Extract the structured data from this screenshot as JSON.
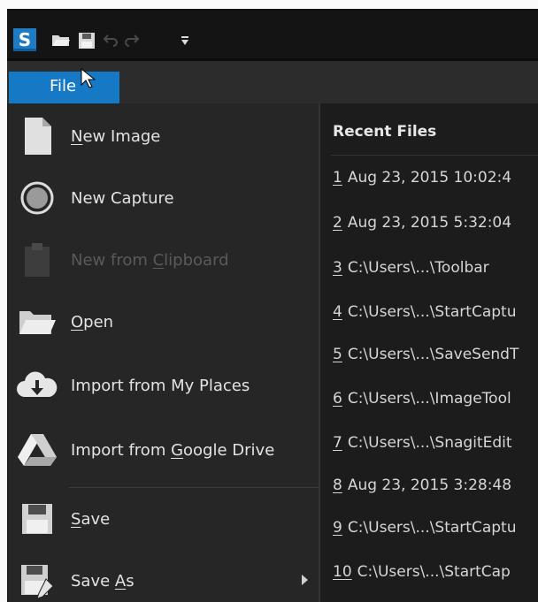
{
  "app": {
    "logo_letter": "S"
  },
  "menubar": {
    "file_tab": "File"
  },
  "file_menu": {
    "items": [
      {
        "label_pre": "",
        "label_u": "N",
        "label_post": "ew Image",
        "icon": "new-image-icon",
        "enabled": true
      },
      {
        "label_pre": "New Capture",
        "label_u": "",
        "label_post": "",
        "icon": "capture-circle-icon",
        "enabled": true
      },
      {
        "label_pre": "New from ",
        "label_u": "C",
        "label_post": "lipboard",
        "icon": "clipboard-icon",
        "enabled": false
      },
      {
        "label_pre": "",
        "label_u": "O",
        "label_post": "pen",
        "icon": "folder-open-icon",
        "enabled": true
      },
      {
        "label_pre": "Import from My Places",
        "label_u": "",
        "label_post": "",
        "icon": "cloud-download-icon",
        "enabled": true
      },
      {
        "label_pre": "Import from ",
        "label_u": "G",
        "label_post": "oogle Drive",
        "icon": "google-drive-icon",
        "enabled": true
      },
      {
        "label_pre": "",
        "label_u": "S",
        "label_post": "ave",
        "icon": "save-icon",
        "enabled": true
      },
      {
        "label_pre": "Save ",
        "label_u": "A",
        "label_post": "s",
        "icon": "save-as-icon",
        "enabled": true,
        "submenu": true
      }
    ]
  },
  "recent_files": {
    "header": "Recent Files",
    "items": [
      {
        "num": "1",
        "text": "Aug 23, 2015 10:02:4"
      },
      {
        "num": "2",
        "text": "Aug 23, 2015 5:32:04"
      },
      {
        "num": "3",
        "text": "C:\\Users\\...\\Toolbar"
      },
      {
        "num": "4",
        "text": "C:\\Users\\...\\StartCaptu"
      },
      {
        "num": "5",
        "text": "C:\\Users\\...\\SaveSendT"
      },
      {
        "num": "6",
        "text": "C:\\Users\\...\\ImageTool"
      },
      {
        "num": "7",
        "text": "C:\\Users\\...\\SnagitEdit"
      },
      {
        "num": "8",
        "text": "Aug 23, 2015 3:28:48"
      },
      {
        "num": "9",
        "text": "C:\\Users\\...\\StartCaptu"
      },
      {
        "num": "10",
        "text": "C:\\Users\\...\\StartCap"
      }
    ]
  },
  "colors": {
    "accent": "#1679c6",
    "background": "#1f1f1f"
  }
}
